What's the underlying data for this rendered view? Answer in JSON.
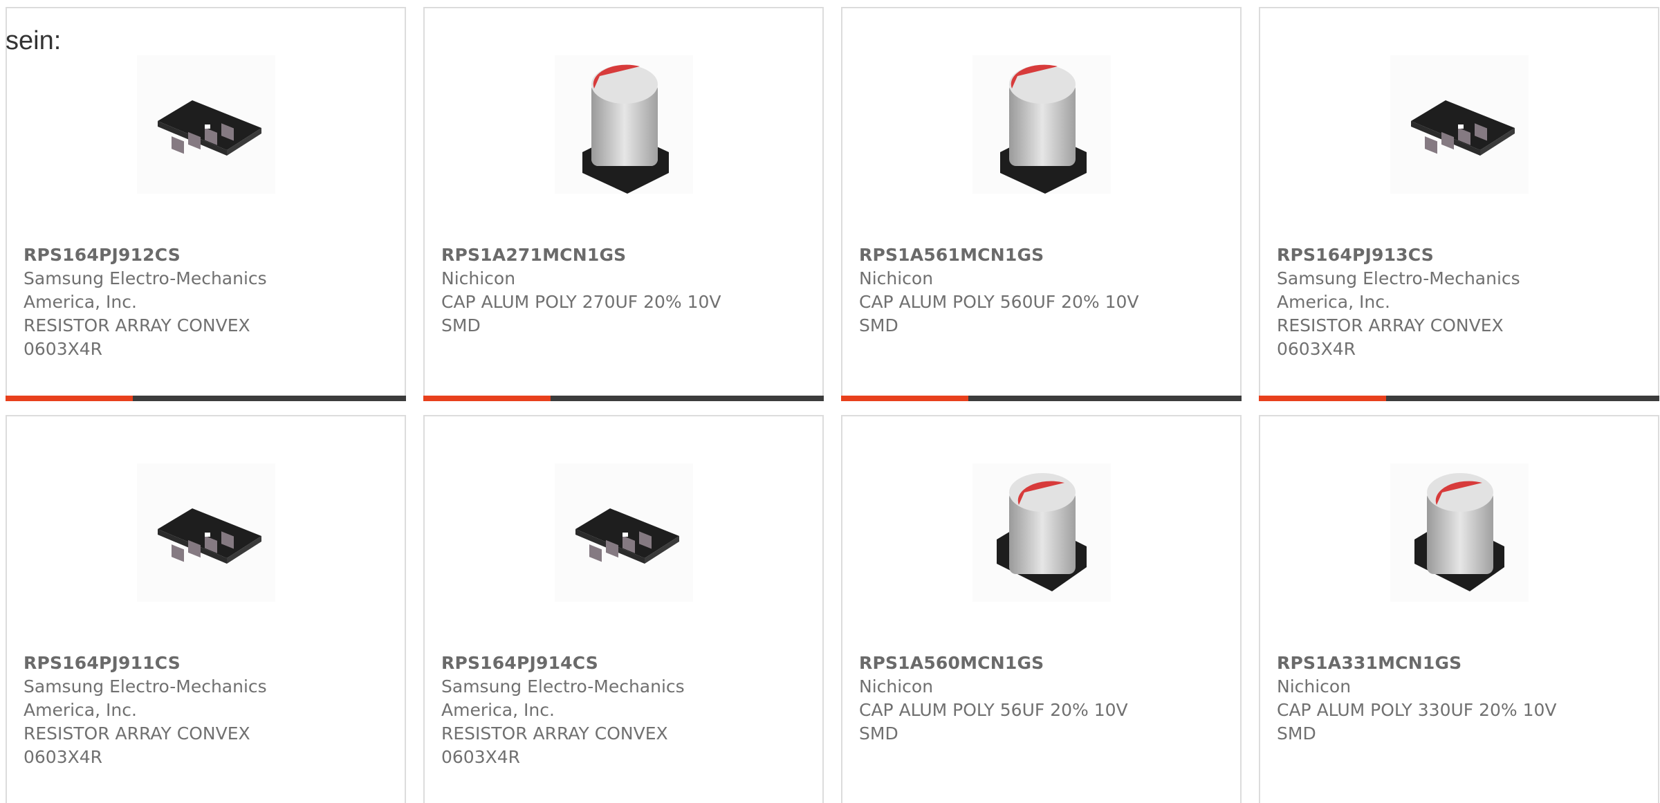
{
  "intro_text": "sein:",
  "colors": {
    "accent": "#e8401c",
    "bar": "#3c3c3c",
    "cap_top": "#d63a3a",
    "cap_body": "#c7c7c7",
    "cap_base": "#1f1f1f",
    "resistor_body": "#1c1c1c",
    "resistor_pad": "#8a7e86"
  },
  "products": [
    {
      "part_number": "RPS164PJ912CS",
      "image_icon": "resistor-array-icon",
      "manufacturer": "Samsung Electro-Mechanics America, Inc.",
      "manufacturer_line1": "Samsung Electro-Mechanics",
      "manufacturer_line2": "America, Inc.",
      "description_line1": "RESISTOR ARRAY CONVEX",
      "description_line2": "0603X4R"
    },
    {
      "part_number": "RPS1A271MCN1GS",
      "image_icon": "aluminum-capacitor-icon",
      "manufacturer_line1": "Nichicon",
      "manufacturer_line2": "",
      "description_line1": "CAP ALUM POLY 270UF 20% 10V",
      "description_line2": "SMD"
    },
    {
      "part_number": "RPS1A561MCN1GS",
      "image_icon": "aluminum-capacitor-icon",
      "manufacturer_line1": "Nichicon",
      "manufacturer_line2": "",
      "description_line1": "CAP ALUM POLY 560UF 20% 10V",
      "description_line2": "SMD"
    },
    {
      "part_number": "RPS164PJ913CS",
      "image_icon": "resistor-array-icon",
      "manufacturer_line1": "Samsung Electro-Mechanics",
      "manufacturer_line2": "America, Inc.",
      "description_line1": "RESISTOR ARRAY CONVEX",
      "description_line2": "0603X4R"
    },
    {
      "part_number": "RPS164PJ911CS",
      "image_icon": "resistor-array-icon",
      "manufacturer_line1": "Samsung Electro-Mechanics",
      "manufacturer_line2": "America, Inc.",
      "description_line1": "RESISTOR ARRAY CONVEX",
      "description_line2": "0603X4R"
    },
    {
      "part_number": "RPS164PJ914CS",
      "image_icon": "resistor-array-icon",
      "manufacturer_line1": "Samsung Electro-Mechanics",
      "manufacturer_line2": "America, Inc.",
      "description_line1": "RESISTOR ARRAY CONVEX",
      "description_line2": "0603X4R"
    },
    {
      "part_number": "RPS1A560MCN1GS",
      "image_icon": "aluminum-capacitor-icon",
      "manufacturer_line1": "Nichicon",
      "manufacturer_line2": "",
      "description_line1": "CAP ALUM POLY 56UF 20% 10V",
      "description_line2": "SMD"
    },
    {
      "part_number": "RPS1A331MCN1GS",
      "image_icon": "aluminum-capacitor-icon",
      "manufacturer_line1": "Nichicon",
      "manufacturer_line2": "",
      "description_line1": "CAP ALUM POLY 330UF 20% 10V",
      "description_line2": "SMD"
    }
  ]
}
